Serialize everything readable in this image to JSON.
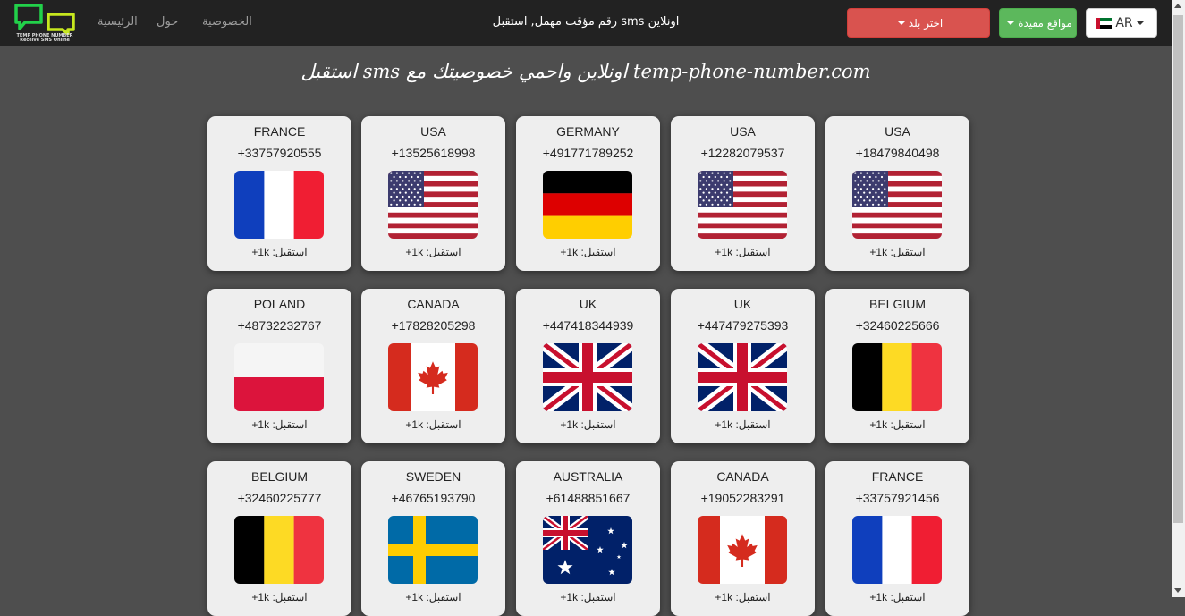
{
  "brand": {
    "logo_line1": "TEMP PHONE NUMBER",
    "logo_line2": "Receive SMS Online"
  },
  "nav": {
    "home": "الرئيسية",
    "about": "حول",
    "privacy": "الخصوصية",
    "center": "رقم مؤقت مهمل, استقبل sms اونلاين"
  },
  "buttons": {
    "choose_country": "اختر بلد",
    "useful_sites": "مواقع مفيدة",
    "language": "AR"
  },
  "headline": "استقبل sms اونلاين واحمي خصوصيتك مع temp-phone-number.com",
  "received_label": "استقبل:",
  "received_value": "1k+",
  "cards": [
    {
      "country": "FRANCE",
      "number": "+33757920555",
      "flag": "france-flag-icon"
    },
    {
      "country": "USA",
      "number": "+13525618998",
      "flag": "usa-flag-icon"
    },
    {
      "country": "GERMANY",
      "number": "+491771789252",
      "flag": "germany-flag-icon"
    },
    {
      "country": "USA",
      "number": "+12282079537",
      "flag": "usa-flag-icon"
    },
    {
      "country": "USA",
      "number": "+18479840498",
      "flag": "usa-flag-icon"
    },
    {
      "country": "POLAND",
      "number": "+48732232767",
      "flag": "poland-flag-icon"
    },
    {
      "country": "CANADA",
      "number": "+17828205298",
      "flag": "canada-flag-icon"
    },
    {
      "country": "UK",
      "number": "+447418344939",
      "flag": "uk-flag-icon"
    },
    {
      "country": "UK",
      "number": "+447479275393",
      "flag": "uk-flag-icon"
    },
    {
      "country": "BELGIUM",
      "number": "+32460225666",
      "flag": "belgium-flag-icon"
    },
    {
      "country": "BELGIUM",
      "number": "+32460225777",
      "flag": "belgium-flag-icon"
    },
    {
      "country": "SWEDEN",
      "number": "+46765193790",
      "flag": "sweden-flag-icon"
    },
    {
      "country": "AUSTRALIA",
      "number": "+61488851667",
      "flag": "australia-flag-icon"
    },
    {
      "country": "CANADA",
      "number": "+19052283291",
      "flag": "canada-flag-icon"
    },
    {
      "country": "FRANCE",
      "number": "+33757921456",
      "flag": "france-flag-icon"
    }
  ],
  "colors": {
    "navbar": "#222222",
    "background": "#4e4e4e",
    "card": "#eeeeee",
    "btn_red": "#d9534f",
    "btn_green": "#5cb85c",
    "logo_green": "#22d14a"
  }
}
